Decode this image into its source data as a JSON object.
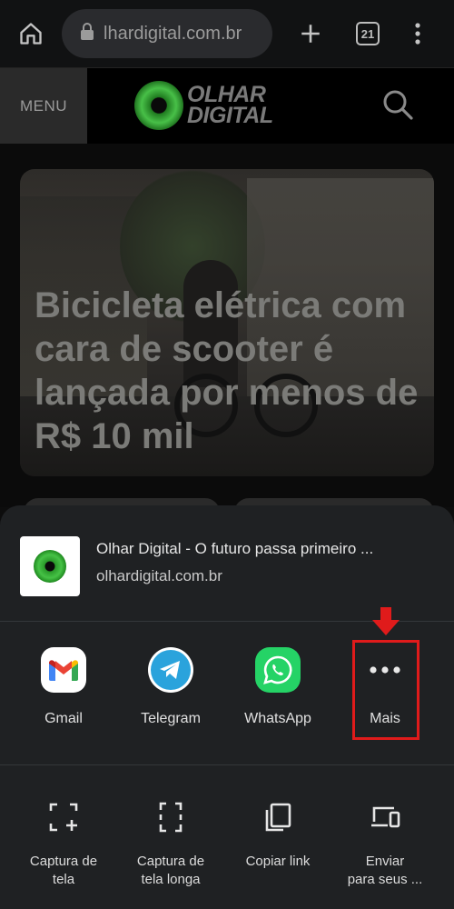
{
  "browser": {
    "url": "lhardigital.com.br",
    "tab_count": "21",
    "icons": {
      "home": "home-icon",
      "lock": "lock-icon",
      "new_tab": "plus-icon",
      "tabs": "tab-switcher-icon",
      "menu": "more-vert-icon"
    }
  },
  "site": {
    "menu_label": "MENU",
    "logo_line1": "OLHAR",
    "logo_line2": "DIGITAL",
    "search_icon": "search-icon"
  },
  "article": {
    "headline": "Bicicleta elétrica com cara de scooter é lançada por menos de R$ 10 mil"
  },
  "share_sheet": {
    "page_title": "Olhar Digital - O futuro passa primeiro ...",
    "page_url": "olhardigital.com.br",
    "apps": [
      {
        "label": "Gmail",
        "icon": "gmail-icon"
      },
      {
        "label": "Telegram",
        "icon": "telegram-icon"
      },
      {
        "label": "WhatsApp",
        "icon": "whatsapp-icon"
      },
      {
        "label": "Mais",
        "icon": "more-horiz-icon"
      }
    ],
    "actions": [
      {
        "label": "Captura de\ntela",
        "icon": "screenshot-icon"
      },
      {
        "label": "Captura de\ntela longa",
        "icon": "long-screenshot-icon"
      },
      {
        "label": "Copiar link",
        "icon": "copy-icon"
      },
      {
        "label": "Enviar\npara seus ...",
        "icon": "send-to-devices-icon"
      }
    ],
    "highlight_color": "#e01b1b"
  }
}
